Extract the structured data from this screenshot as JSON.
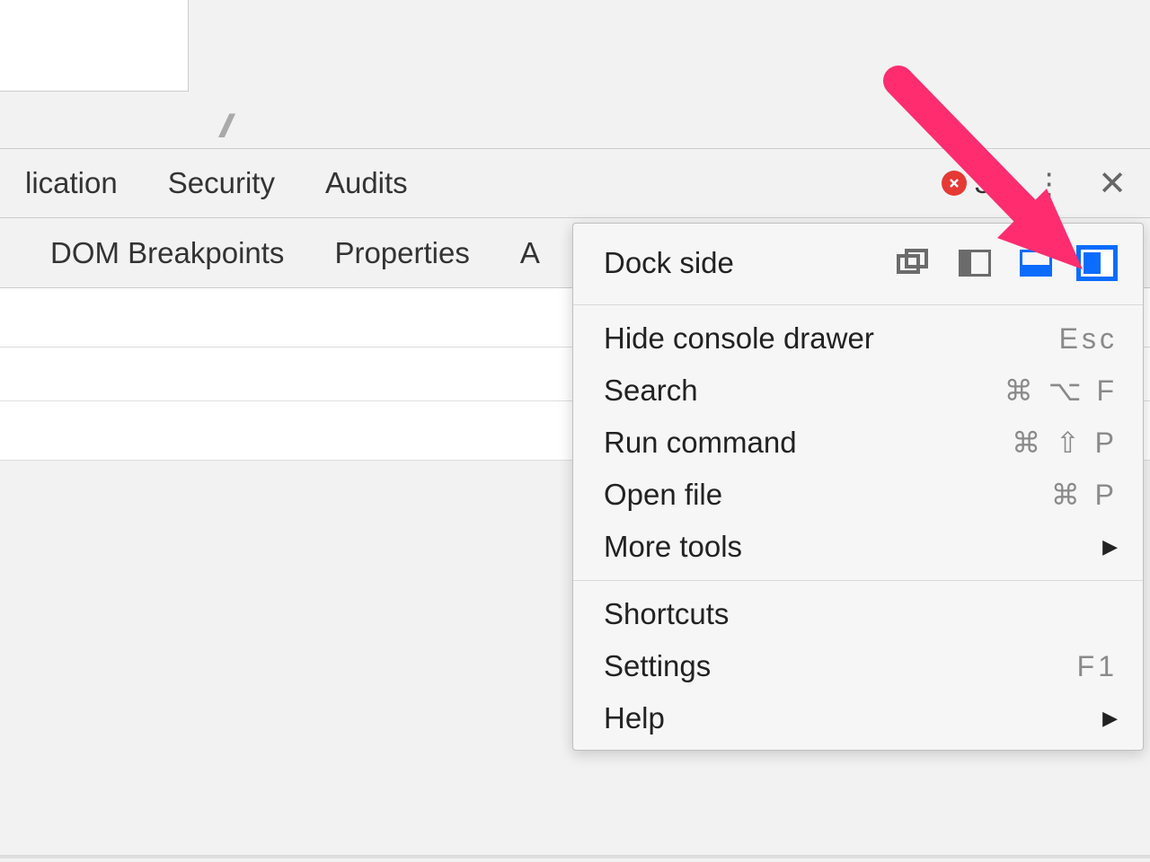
{
  "toolbar": {
    "tabs": [
      "lication",
      "Security",
      "Audits"
    ],
    "error_count": "30"
  },
  "subbar": {
    "tabs": [
      "DOM Breakpoints",
      "Properties",
      "A"
    ]
  },
  "menu": {
    "dock_label": "Dock side",
    "items": {
      "hide_console": "Hide console drawer",
      "hide_console_sc": "Esc",
      "search": "Search",
      "search_sc": "⌘ ⌥ F",
      "run_command": "Run command",
      "run_command_sc": "⌘ ⇧ P",
      "open_file": "Open file",
      "open_file_sc": "⌘ P",
      "more_tools": "More tools",
      "shortcuts": "Shortcuts",
      "settings": "Settings",
      "settings_sc": "F1",
      "help": "Help"
    }
  }
}
